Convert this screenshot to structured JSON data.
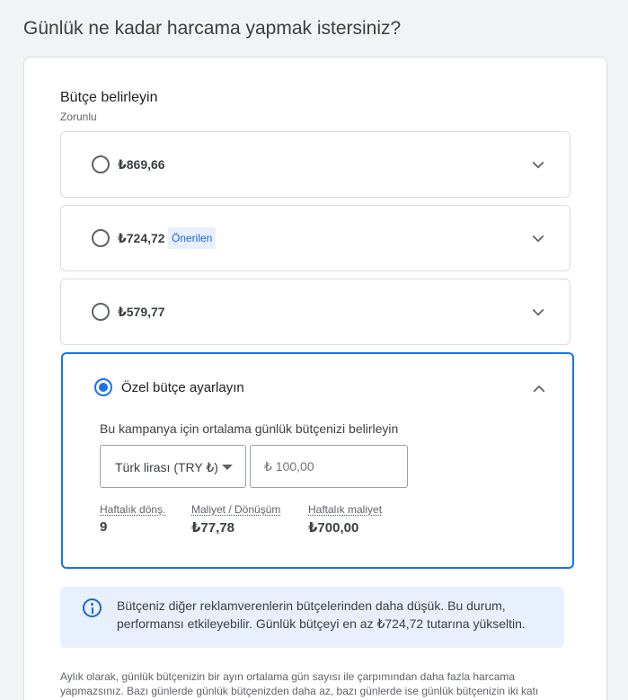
{
  "page": {
    "title": "Günlük ne kadar harcama yapmak istersiniz?"
  },
  "budget": {
    "section_title": "Bütçe belirleyin",
    "required_label": "Zorunlu",
    "options": [
      {
        "label": "₺869,66",
        "selected": false,
        "badge": ""
      },
      {
        "label": "₺724,72",
        "selected": false,
        "badge": "Önerilen"
      },
      {
        "label": "₺579,77",
        "selected": false,
        "badge": ""
      }
    ],
    "custom": {
      "label": "Özel bütçe ayarlayın",
      "selected": true,
      "description": "Bu kampanya için ortalama günlük bütçenizi belirleyin",
      "currency_value": "Türk lirası (TRY ₺)",
      "amount_placeholder": "₺ 100,00",
      "stats": [
        {
          "label": "Haftalık dönş.",
          "value": "9"
        },
        {
          "label": "Maliyet / Dönüşüm",
          "value": "₺77,78"
        },
        {
          "label": "Haftalık maliyet",
          "value": "₺700,00"
        }
      ]
    }
  },
  "info": {
    "text": "Bütçeniz diğer reklamverenlerin bütçelerinden daha düşük. Bu durum, performansı etkileyebilir. Günlük bütçeyi en az ₺724,72 tutarına yükseltin."
  },
  "footnote": {
    "text": "Aylık olarak, günlük bütçenizin bir ayın ortalama gün sayısı ile çarpımından daha fazla harcama yapmazsınız. Bazı günlerde günlük bütçenizden daha az, bazı günlerde ise günlük bütçenizin iki katı"
  },
  "colors": {
    "accent": "#1a73e8",
    "info_bg": "#e8f0fe",
    "border": "#dadce0"
  }
}
